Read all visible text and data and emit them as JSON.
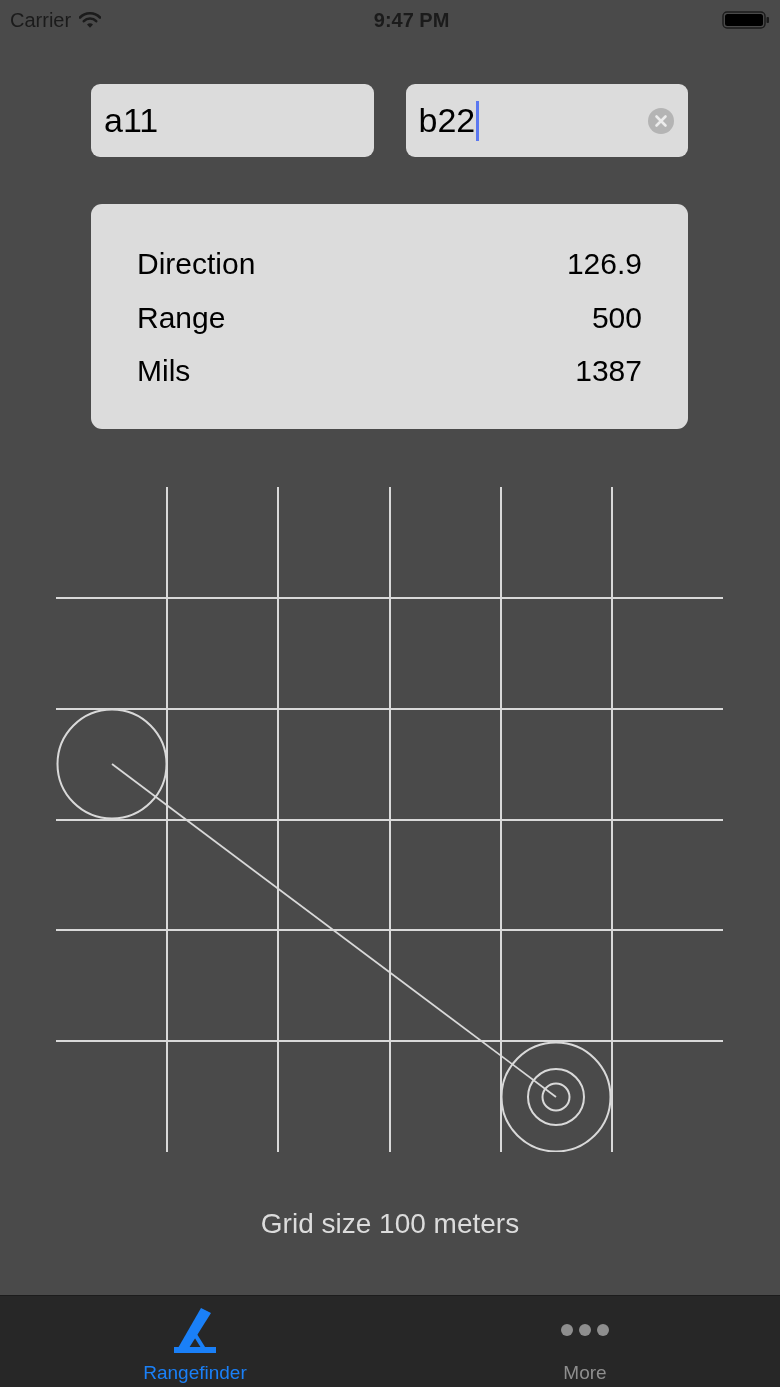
{
  "status_bar": {
    "carrier": "Carrier",
    "time": "9:47 PM"
  },
  "fields": [
    {
      "value": "a11",
      "focused": false
    },
    {
      "value": "b22",
      "focused": true
    }
  ],
  "results": [
    {
      "label": "Direction",
      "value": "126.9"
    },
    {
      "label": "Range",
      "value": "500"
    },
    {
      "label": "Mils",
      "value": "1387"
    }
  ],
  "grid": {
    "caption": "Grid size 100 meters"
  },
  "tab_bar": [
    {
      "label": "Rangefinder",
      "kind": "rangefinder",
      "selected": true
    },
    {
      "label": "More",
      "kind": "more",
      "selected": false
    }
  ]
}
